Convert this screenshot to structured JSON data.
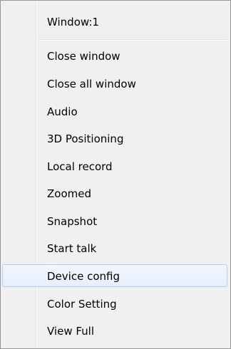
{
  "menu": {
    "header": "Window:1",
    "items": [
      {
        "label": "Close window"
      },
      {
        "label": "Close all window"
      },
      {
        "label": "Audio"
      },
      {
        "label": "3D Positioning"
      },
      {
        "label": "Local record"
      },
      {
        "label": "Zoomed"
      },
      {
        "label": "Snapshot"
      },
      {
        "label": "Start talk"
      },
      {
        "label": "Device config",
        "highlighted": true
      },
      {
        "label": "Color Setting"
      },
      {
        "label": "View Full"
      }
    ]
  }
}
